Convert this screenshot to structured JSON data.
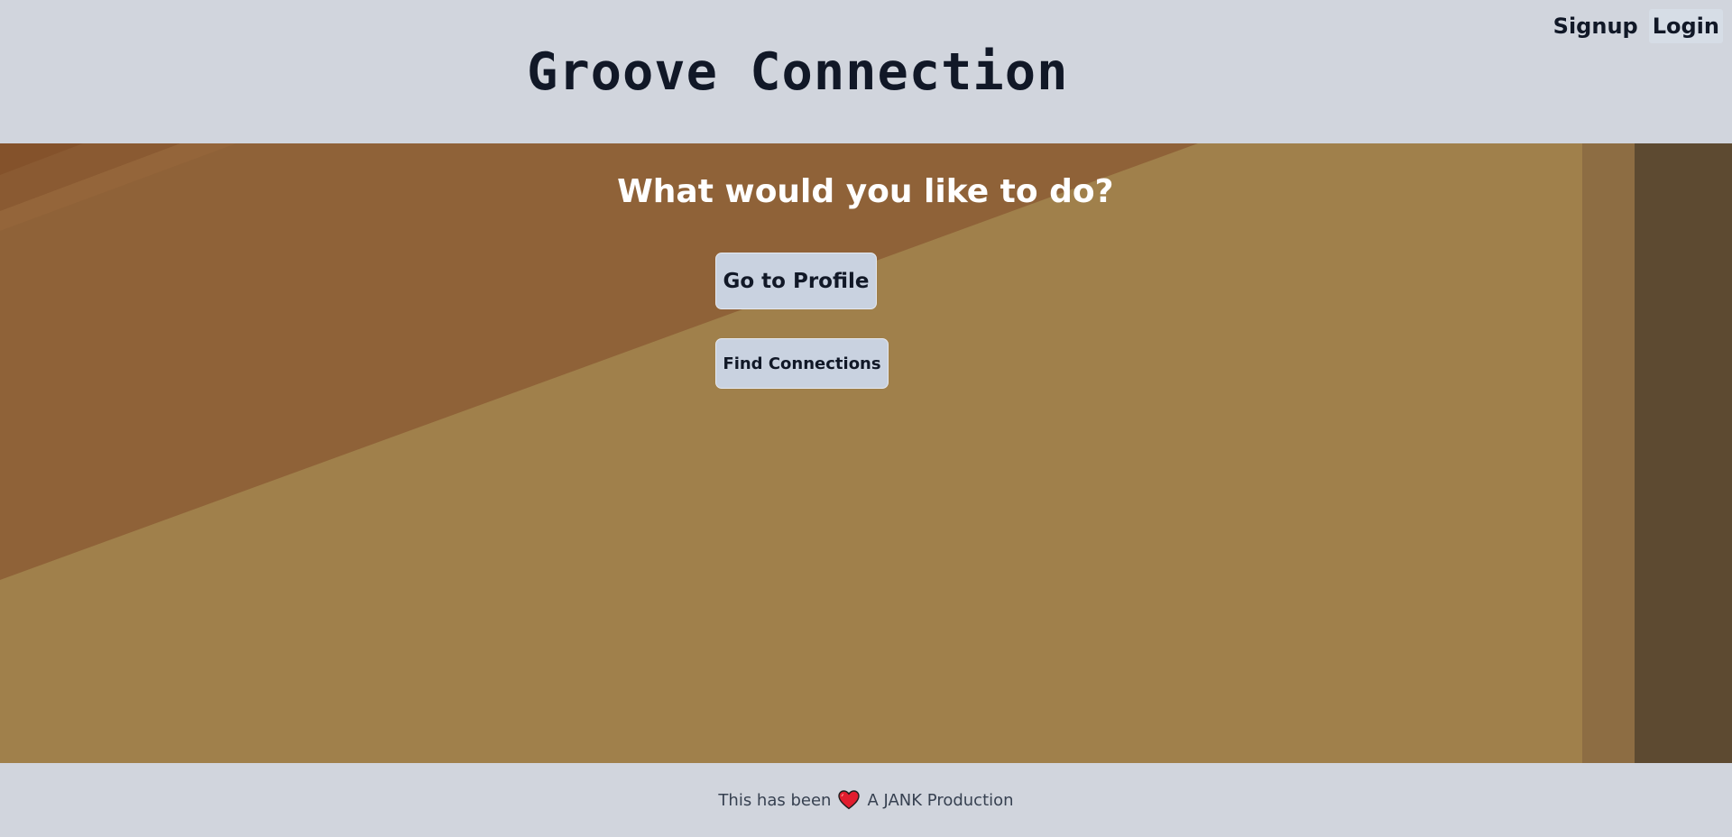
{
  "header": {
    "title": "Groove Connection",
    "nav": {
      "signup_label": "Signup",
      "login_label": "Login"
    }
  },
  "hero": {
    "heading": "What would you like to do?",
    "actions": {
      "profile_label": "Go to Profile",
      "connections_label": "Find Connections"
    }
  },
  "footer": {
    "text_before": "This has been",
    "icon": "heart-icon",
    "text_after": "A JANK Production"
  },
  "colors": {
    "page_bg": "#d1d5dd",
    "title_text": "#111827",
    "hero_light": "#a0804b",
    "hero_dark": "#8f6238",
    "button_bg": "#c9d2e0",
    "heart": "#e11d2e"
  }
}
